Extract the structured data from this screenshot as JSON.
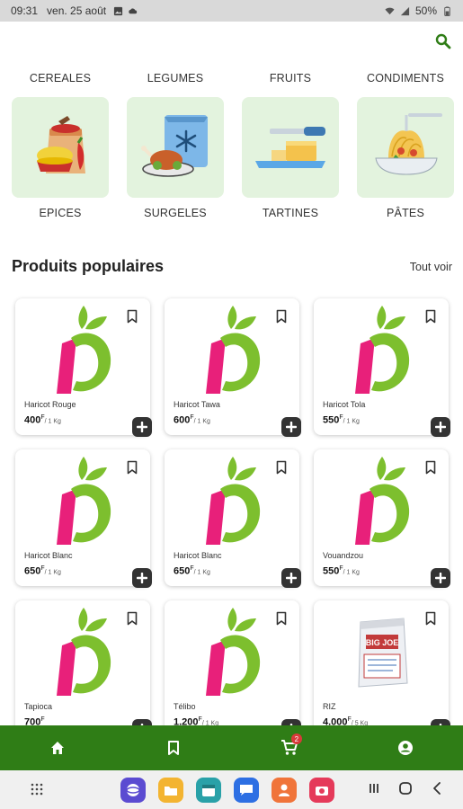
{
  "status_bar": {
    "time": "09:31",
    "date": "ven. 25 août",
    "battery": "50%",
    "icons": [
      "image-icon",
      "cloud-icon",
      "wifi-icon",
      "signal-icon",
      "battery-icon"
    ]
  },
  "header": {
    "search_icon": "search-icon"
  },
  "categories": {
    "top": [
      "CEREALES",
      "LEGUMES",
      "FRUITS",
      "CONDIMENTS"
    ],
    "tiles": [
      {
        "label": "EPICES",
        "icon": "spice-sack-icon"
      },
      {
        "label": "SURGELES",
        "icon": "frozen-food-icon"
      },
      {
        "label": "TARTINES",
        "icon": "butter-knife-icon"
      },
      {
        "label": "PÂTES",
        "icon": "pasta-bowl-icon"
      }
    ]
  },
  "popular": {
    "title": "Produits populaires",
    "see_all": "Tout voir",
    "products": [
      {
        "name": "Haricot Rouge",
        "price": "400",
        "currency": "F",
        "unit": "/ 1 Kg",
        "image": "brand-logo"
      },
      {
        "name": "Haricot Tawa",
        "price": "600",
        "currency": "F",
        "unit": "/ 1 Kg",
        "image": "brand-logo"
      },
      {
        "name": "Haricot Tola",
        "price": "550",
        "currency": "F",
        "unit": "/ 1 Kg",
        "image": "brand-logo"
      },
      {
        "name": "Haricot Blanc",
        "price": "650",
        "currency": "F",
        "unit": "/ 1 Kg",
        "image": "brand-logo"
      },
      {
        "name": "Haricot Blanc",
        "price": "650",
        "currency": "F",
        "unit": "/ 1 Kg",
        "image": "brand-logo"
      },
      {
        "name": "Vouandzou",
        "price": "550",
        "currency": "F",
        "unit": "/ 1 Kg",
        "image": "brand-logo"
      },
      {
        "name": "Tapioca",
        "price": "700",
        "currency": "F",
        "unit": "",
        "image": "brand-logo"
      },
      {
        "name": "Télibo",
        "price": "1.200",
        "currency": "F",
        "unit": "/ 1 Kg",
        "image": "brand-logo"
      },
      {
        "name": "RIZ",
        "price": "4.000",
        "currency": "F",
        "unit": "/ 5 Kg",
        "image": "rice-bag",
        "bag_text": "BIG JOE"
      }
    ]
  },
  "bottom_nav": {
    "items": [
      "home-icon",
      "bookmark-icon",
      "cart-icon",
      "account-icon"
    ],
    "cart_count": "2"
  },
  "colors": {
    "brand_green": "#2f7d16",
    "tile_bg": "#e3f3de",
    "logo_pink": "#e8207a",
    "logo_green": "#7dbf2e"
  }
}
